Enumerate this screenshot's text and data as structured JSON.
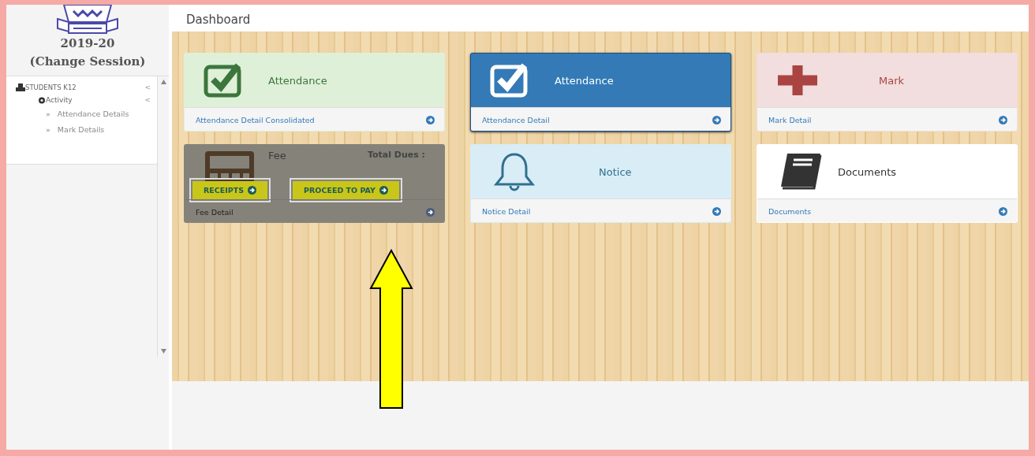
{
  "sidebar": {
    "session": "2019-20",
    "change_session": "(Change Session)",
    "menu": [
      {
        "label": "STUDENTS K12",
        "caret": "<",
        "expanded": true,
        "children": [
          {
            "label": "Activity",
            "caret": "<",
            "expanded": true,
            "children": [
              {
                "bullet": "»",
                "label": "Attendance Details"
              },
              {
                "bullet": "»",
                "label": "Mark Details"
              }
            ]
          }
        ]
      }
    ]
  },
  "header": {
    "title": "Dashboard"
  },
  "cards": [
    {
      "kind": "check",
      "color": "#dff0d8",
      "title": "Attendance",
      "footer": "Attendance Detail Consolidated",
      "selected": false
    },
    {
      "kind": "check-box",
      "color": "#337ab7",
      "title": "Attendance",
      "footer": "Attendance Detail",
      "selected": true
    },
    {
      "kind": "plus",
      "color": "#f2dede",
      "title": "Mark",
      "footer": "Mark Detail",
      "selected": false
    },
    {
      "kind": "fee",
      "color": "#858279",
      "title": "Fee",
      "dues": "Total Dues :",
      "footer": "Fee Detail",
      "selected": false,
      "buttons": [
        "RECEIPTS",
        "PROCEED TO PAY"
      ]
    },
    {
      "kind": "bell",
      "color": "#d9edf7",
      "title": "Notice",
      "footer": "Notice Detail",
      "selected": false
    },
    {
      "kind": "book",
      "color": "#ffffff",
      "title": "Documents",
      "footer": "Documents",
      "selected": false
    }
  ]
}
